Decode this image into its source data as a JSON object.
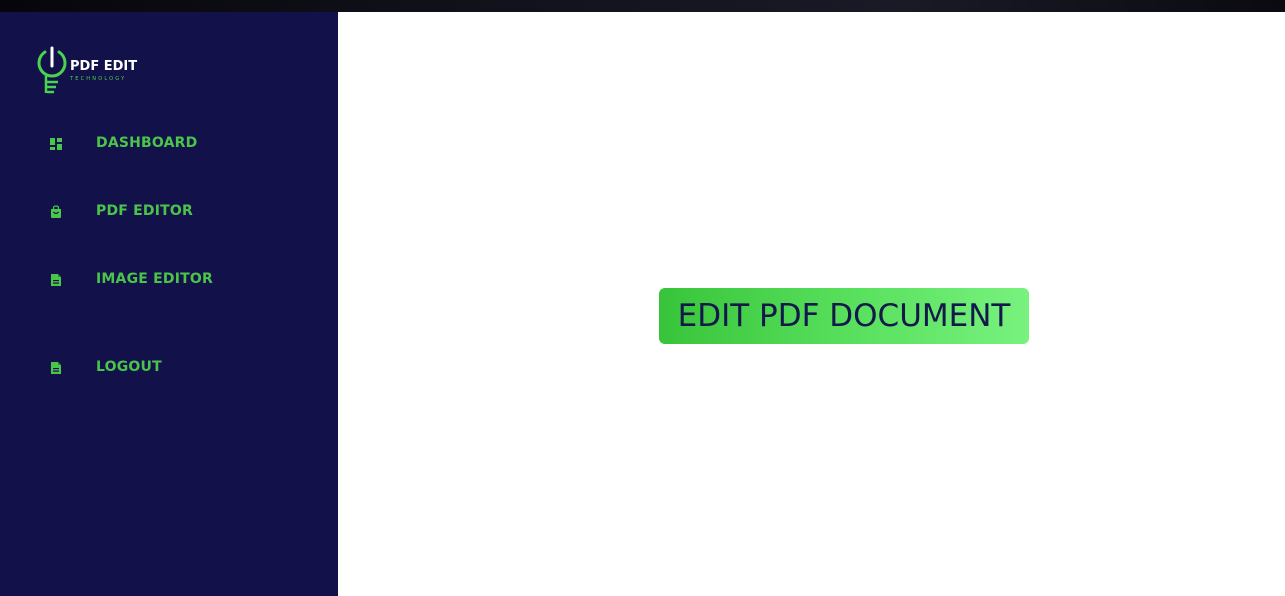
{
  "logo": {
    "title": "PDF EDIT",
    "subtitle": "TECHNOLOGY"
  },
  "sidebar": {
    "items": [
      {
        "label": "DASHBOARD",
        "icon": "dashboard-icon"
      },
      {
        "label": "PDF EDITOR",
        "icon": "bag-icon"
      },
      {
        "label": "IMAGE EDITOR",
        "icon": "document-icon"
      },
      {
        "label": "LOGOUT",
        "icon": "document-icon"
      }
    ]
  },
  "main": {
    "button_label": "EDIT PDF DOCUMENT"
  },
  "colors": {
    "sidebar_bg": "#13114a",
    "accent_green": "#49c54a",
    "button_text": "#13184a"
  }
}
